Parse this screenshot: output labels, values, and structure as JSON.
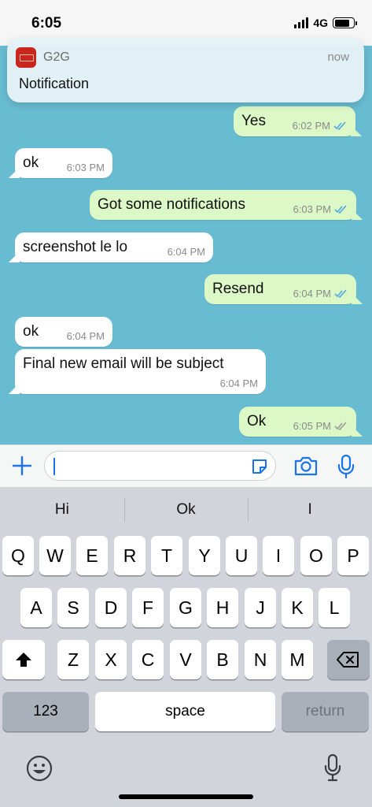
{
  "status_bar": {
    "time": "6:05",
    "network": "4G"
  },
  "notification": {
    "app_name": "G2G",
    "time": "now",
    "body": "Notification"
  },
  "messages": [
    {
      "dir": "out",
      "text": "Yes",
      "time": "6:02 PM",
      "ticks": "read"
    },
    {
      "dir": "in",
      "text": "ok",
      "time": "6:03 PM"
    },
    {
      "dir": "out",
      "text": "Got some notifications",
      "time": "6:03 PM",
      "ticks": "read"
    },
    {
      "dir": "in",
      "text": "screenshot le lo",
      "time": "6:04 PM"
    },
    {
      "dir": "out",
      "text": "Resend",
      "time": "6:04 PM",
      "ticks": "read"
    },
    {
      "dir": "in",
      "text": "ok",
      "time": "6:04 PM"
    },
    {
      "dir": "in",
      "text": "Final new email will be subject",
      "time": "6:04 PM"
    },
    {
      "dir": "out",
      "text": "Ok",
      "time": "6:05 PM",
      "ticks": "delivered"
    }
  ],
  "input": {
    "value": ""
  },
  "keyboard": {
    "suggestions": [
      "Hi",
      "Ok",
      "I"
    ],
    "row1": [
      "Q",
      "W",
      "E",
      "R",
      "T",
      "Y",
      "U",
      "I",
      "O",
      "P"
    ],
    "row2": [
      "A",
      "S",
      "D",
      "F",
      "G",
      "H",
      "J",
      "K",
      "L"
    ],
    "row3": [
      "Z",
      "X",
      "C",
      "V",
      "B",
      "N",
      "M"
    ],
    "numbers_label": "123",
    "space_label": "space",
    "return_label": "return"
  },
  "colors": {
    "chat_bg": "#68bcd2",
    "outgoing_bubble": "#dcf8c6",
    "incoming_bubble": "#ffffff",
    "read_ticks": "#4fa7e3",
    "accent": "#1a73e8"
  },
  "icons": {
    "plus": "plus-icon",
    "sticker": "sticker-icon",
    "camera": "camera-icon",
    "mic": "microphone-icon",
    "shift": "shift-icon",
    "backspace": "backspace-icon",
    "emoji": "emoji-icon",
    "dictation": "dictation-icon"
  }
}
